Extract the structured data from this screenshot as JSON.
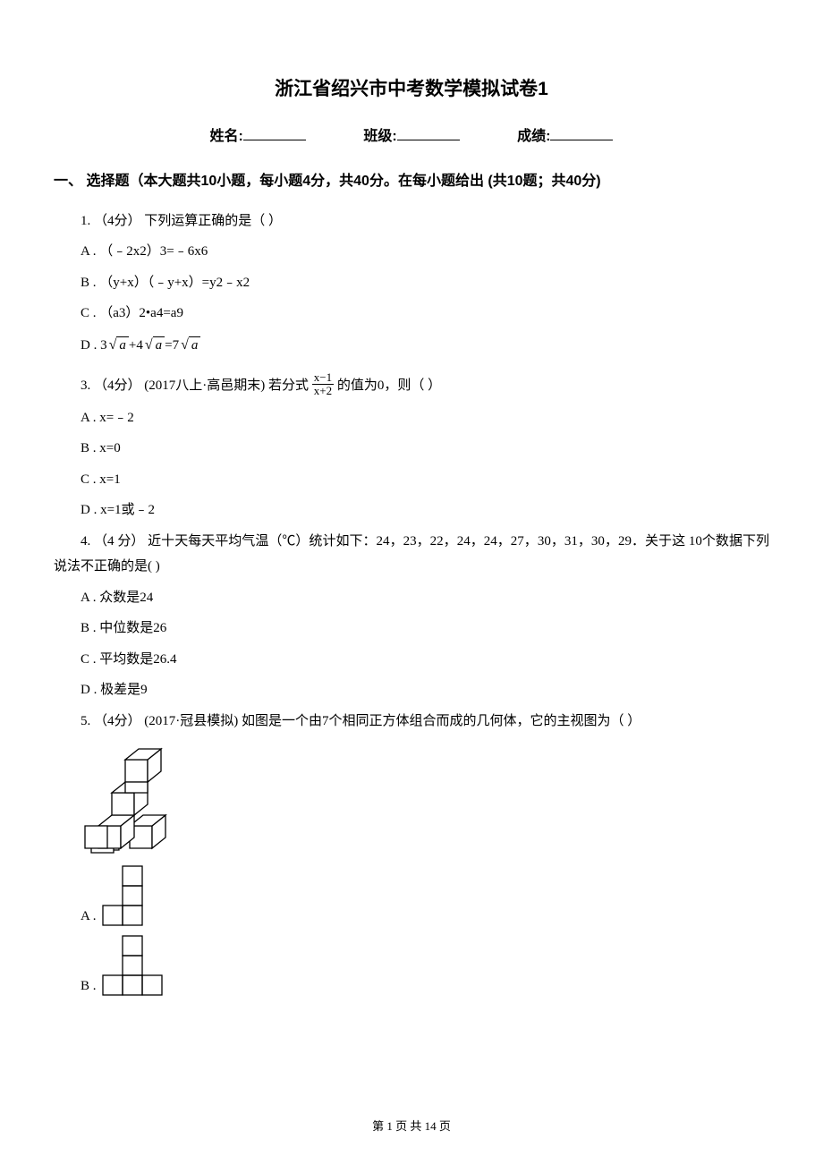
{
  "title": "浙江省绍兴市中考数学模拟试卷1",
  "info": {
    "name_label": "姓名:",
    "class_label": "班级:",
    "score_label": "成绩:"
  },
  "section1": "一、 选择题（本大题共10小题，每小题4分，共40分。在每小题给出 (共10题；共40分)",
  "q1": {
    "stem": "1. （4分） 下列运算正确的是（   ）",
    "A": "A . （﹣2x2）3=﹣6x6",
    "B": "B . （y+x）（﹣y+x）=y2﹣x2",
    "C": "C . （a3）2•a4=a9",
    "D_prefix": "D . 3",
    "D_mid": "+4",
    "D_eq": "=7",
    "D_rad": "a"
  },
  "q3": {
    "stem_pre": "3. （4分） (2017八上·高邑期末) 若分式 ",
    "frac_num": "x−1",
    "frac_den": "x+2",
    "stem_post": " 的值为0，则（   ）",
    "A": "A . x=﹣2",
    "B": "B . x=0",
    "C": "C . x=1",
    "D": "D . x=1或﹣2"
  },
  "q4": {
    "stem": "4. （4 分） 近十天每天平均气温（℃）统计如下：24，23，22，24，24，27，30，31，30，29．关于这 10个数据下列说法不正确的是(    )",
    "A": "A . 众数是24",
    "B": "B . 中位数是26",
    "C": "C . 平均数是26.4",
    "D": "D . 极差是9"
  },
  "q5": {
    "stem": "5. （4分） (2017·冠县模拟) 如图是一个由7个相同正方体组合而成的几何体，它的主视图为（   ）",
    "optA": "A .",
    "optB": "B ."
  },
  "footer": "第 1 页 共 14 页"
}
